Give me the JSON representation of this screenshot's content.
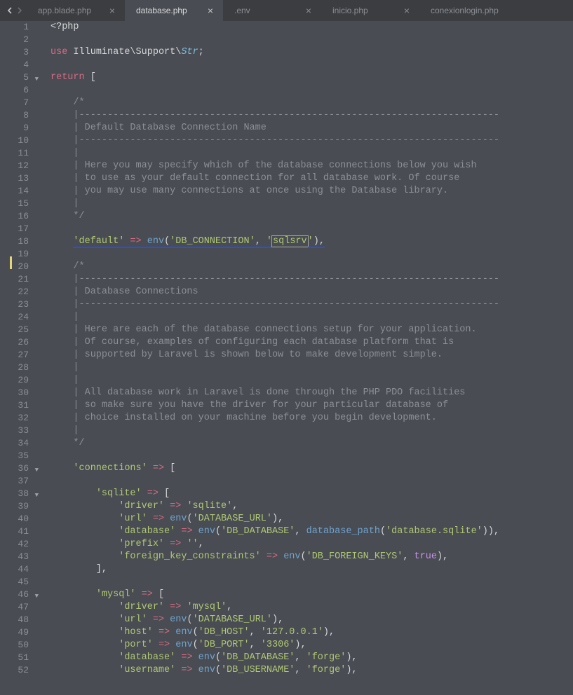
{
  "nav": {
    "left_enabled": true,
    "right_enabled": false
  },
  "tabs": [
    {
      "label": "app.blade.php",
      "active": false,
      "closable": true
    },
    {
      "label": "database.php",
      "active": true,
      "closable": true
    },
    {
      "label": ".env",
      "active": false,
      "closable": true
    },
    {
      "label": "inicio.php",
      "active": false,
      "closable": true
    },
    {
      "label": "conexionlogin.php",
      "active": false,
      "closable": false
    }
  ],
  "gutter": {
    "start": 1,
    "end": 52,
    "folds": [
      5,
      36,
      38,
      46
    ],
    "highlight": 18
  },
  "code": {
    "l1": {
      "php_open": "<?php"
    },
    "l3": {
      "use": "use",
      "ns": "Illuminate\\Support\\",
      "cls": "Str",
      "semi": ";"
    },
    "l5": {
      "ret": "return",
      "br": "["
    },
    "l7": "    /*",
    "l8": "    |--------------------------------------------------------------------------",
    "l9": "    | Default Database Connection Name",
    "l10": "    |--------------------------------------------------------------------------",
    "l11": "    |",
    "l12": "    | Here you may specify which of the database connections below you wish",
    "l13": "    | to use as your default connection for all database work. Of course",
    "l14": "    | you may use many connections at once using the Database library.",
    "l15": "    |",
    "l16": "    */",
    "l18": {
      "key": "'default'",
      "arrow": "=>",
      "fn": "env",
      "arg1": "'DB_CONNECTION'",
      "arg2": "sqlsrv",
      "close": "),"
    },
    "l20": "    /*",
    "l21": "    |--------------------------------------------------------------------------",
    "l22": "    | Database Connections",
    "l23": "    |--------------------------------------------------------------------------",
    "l24": "    |",
    "l25": "    | Here are each of the database connections setup for your application.",
    "l26": "    | Of course, examples of configuring each database platform that is",
    "l27": "    | supported by Laravel is shown below to make development simple.",
    "l28": "    |",
    "l29": "    |",
    "l30": "    | All database work in Laravel is done through the PHP PDO facilities",
    "l31": "    | so make sure you have the driver for your particular database of",
    "l32": "    | choice installed on your machine before you begin development.",
    "l33": "    |",
    "l34": "    */",
    "l36": {
      "key": "'connections'",
      "arrow": "=>",
      "br": "["
    },
    "l38": {
      "key": "'sqlite'",
      "arrow": "=>",
      "br": "["
    },
    "l39": {
      "key": "'driver'",
      "arrow": "=>",
      "val": "'sqlite'",
      "comma": ","
    },
    "l40": {
      "key": "'url'",
      "arrow": "=>",
      "fn": "env",
      "arg1": "'DATABASE_URL'",
      "close": "),"
    },
    "l41": {
      "key": "'database'",
      "arrow": "=>",
      "fn": "env",
      "arg1": "'DB_DATABASE'",
      "fn2": "database_path",
      "arg2q": "'database.sqlite'",
      "close2": ")),"
    },
    "l42": {
      "key": "'prefix'",
      "arrow": "=>",
      "val": "''",
      "comma": ","
    },
    "l43": {
      "key": "'foreign_key_constraints'",
      "arrow": "=>",
      "fn": "env",
      "arg1": "'DB_FOREIGN_KEYS'",
      "bool": "true",
      "close": "),"
    },
    "l44": "        ],",
    "l46": {
      "key": "'mysql'",
      "arrow": "=>",
      "br": "["
    },
    "l47": {
      "key": "'driver'",
      "arrow": "=>",
      "val": "'mysql'",
      "comma": ","
    },
    "l48": {
      "key": "'url'",
      "arrow": "=>",
      "fn": "env",
      "arg1": "'DATABASE_URL'",
      "close": "),"
    },
    "l49": {
      "key": "'host'",
      "arrow": "=>",
      "fn": "env",
      "arg1": "'DB_HOST'",
      "arg2q": "'127.0.0.1'",
      "close": "),"
    },
    "l50": {
      "key": "'port'",
      "arrow": "=>",
      "fn": "env",
      "arg1": "'DB_PORT'",
      "arg2q": "'3306'",
      "close": "),"
    },
    "l51": {
      "key": "'database'",
      "arrow": "=>",
      "fn": "env",
      "arg1": "'DB_DATABASE'",
      "arg2q": "'forge'",
      "close": "),"
    },
    "l52": {
      "key": "'username'",
      "arrow": "=>",
      "fn": "env",
      "arg1": "'DB_USERNAME'",
      "arg2q": "'forge'",
      "close": "),"
    }
  }
}
